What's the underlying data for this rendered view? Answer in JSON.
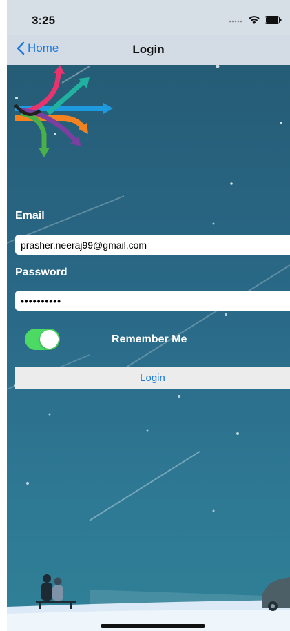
{
  "status_bar": {
    "time": "3:25"
  },
  "nav": {
    "back_label": "Home",
    "title": "Login"
  },
  "form": {
    "email_label": "Email",
    "email_value": "prasher.neeraj99@gmail.com",
    "password_label": "Password",
    "password_value": "••••••••••",
    "remember_label": "Remember Me",
    "remember_on": true,
    "login_label": "Login"
  },
  "colors": {
    "accent": "#1f7ae0",
    "toggle_on": "#4cd964",
    "scene_top": "#255c76",
    "scene_bottom": "#2f8196"
  },
  "icons": [
    "chevron-left-icon",
    "wifi-icon",
    "battery-icon",
    "cellular-signal-icon",
    "app-logo-arrows"
  ]
}
